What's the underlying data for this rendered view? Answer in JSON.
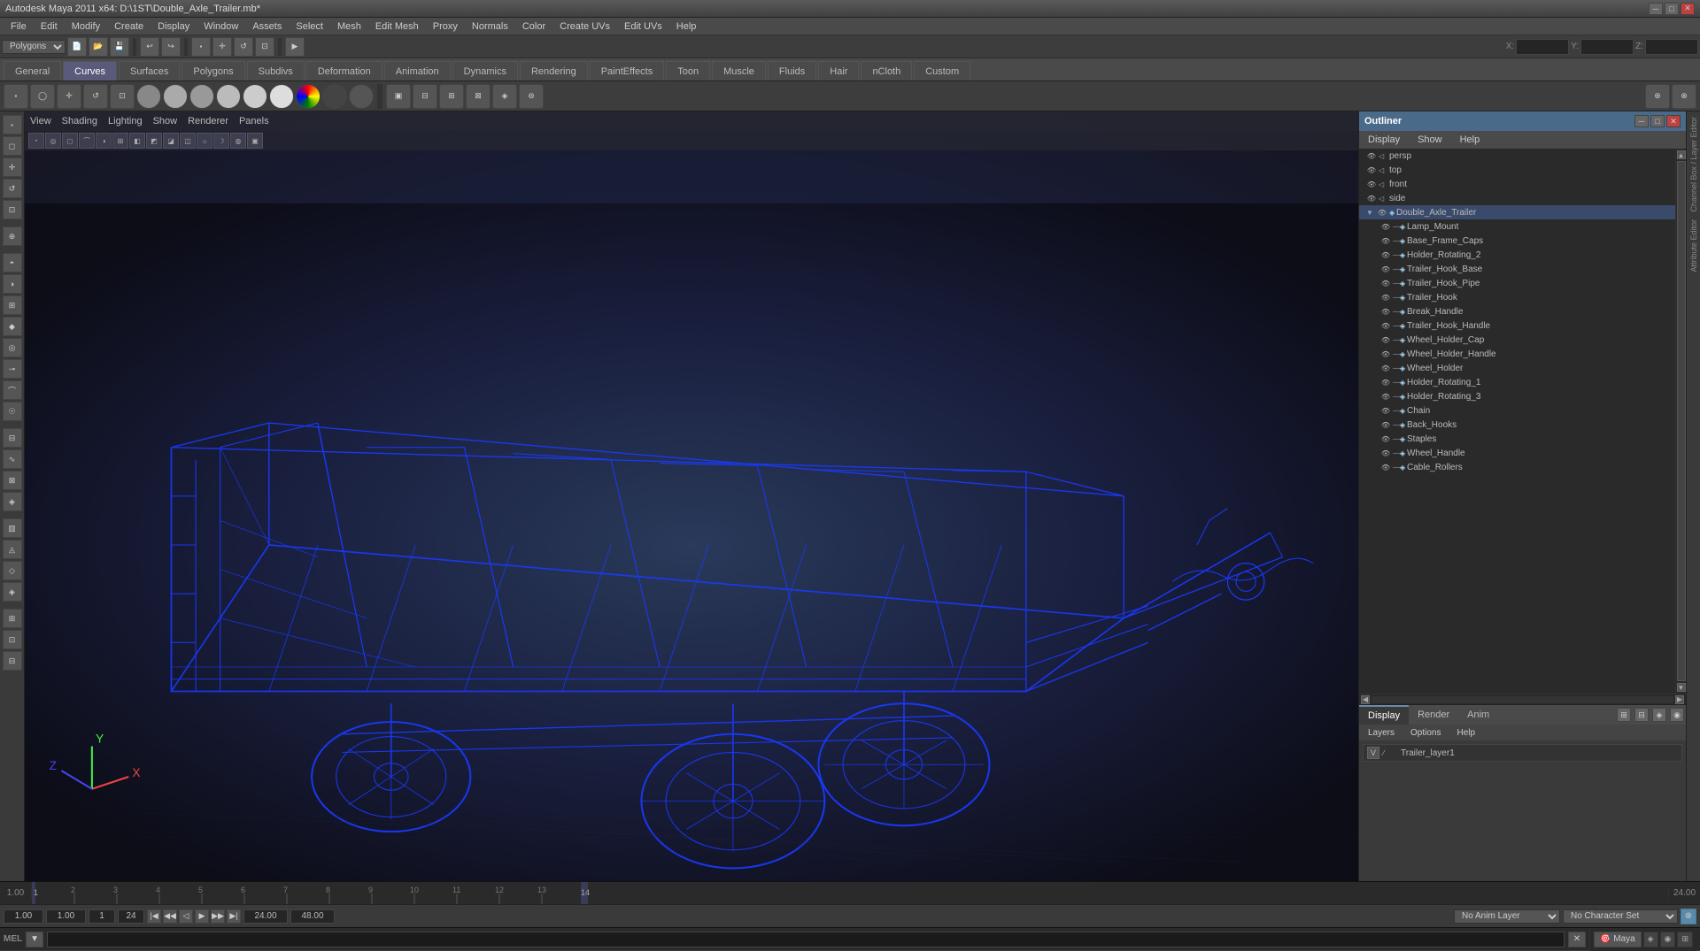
{
  "titleBar": {
    "title": "Autodesk Maya 2011 x64: D:\\1ST\\Double_Axle_Trailer.mb*",
    "btnMin": "─",
    "btnMax": "□",
    "btnClose": "✕"
  },
  "menuBar": {
    "items": [
      "File",
      "Edit",
      "Modify",
      "Create",
      "Display",
      "Window",
      "Assets",
      "Select",
      "Mesh",
      "Edit Mesh",
      "Proxy",
      "Normals",
      "Color",
      "Create UVs",
      "Edit UVs",
      "Help"
    ]
  },
  "modeSelector": {
    "current": "Polygons"
  },
  "tabs": {
    "items": [
      "General",
      "Curves",
      "Surfaces",
      "Polygons",
      "Subdiv s",
      "Deformation",
      "Animation",
      "Dynamics",
      "Rendering",
      "PaintEffects",
      "Toon",
      "Muscle",
      "Fluids",
      "Hair",
      "nCloth",
      "Custom"
    ]
  },
  "viewport": {
    "menus": [
      "View",
      "Shading",
      "Lighting",
      "Show",
      "Renderer",
      "Panels"
    ]
  },
  "outliner": {
    "title": "Outliner",
    "menuItems": [
      "Display",
      "Help",
      "Show"
    ],
    "items": [
      {
        "label": "persp",
        "indent": 0,
        "hasEye": true,
        "hasTri": false
      },
      {
        "label": "top",
        "indent": 0,
        "hasEye": true,
        "hasTri": false
      },
      {
        "label": "front",
        "indent": 0,
        "hasEye": true,
        "hasTri": false
      },
      {
        "label": "side",
        "indent": 0,
        "hasEye": true,
        "hasTri": false
      },
      {
        "label": "Double_Axle_Trailer",
        "indent": 0,
        "hasEye": true,
        "hasTri": true
      },
      {
        "label": "Lamp_Mount",
        "indent": 1
      },
      {
        "label": "Base_Frame_Caps",
        "indent": 1
      },
      {
        "label": "Holder_Rotating_2",
        "indent": 1
      },
      {
        "label": "Trailer_Hook_Base",
        "indent": 1
      },
      {
        "label": "Trailer_Hook_Pipe",
        "indent": 1
      },
      {
        "label": "Trailer_Hook",
        "indent": 1
      },
      {
        "label": "Break_Handle",
        "indent": 1
      },
      {
        "label": "Trailer_Hook_Handle",
        "indent": 1
      },
      {
        "label": "Wheel_Holder_Cap",
        "indent": 1
      },
      {
        "label": "Wheel_Holder_Handle",
        "indent": 1
      },
      {
        "label": "Wheel_Holder",
        "indent": 1
      },
      {
        "label": "Holder_Rotating_1",
        "indent": 1
      },
      {
        "label": "Holder_Rotating_3",
        "indent": 1
      },
      {
        "label": "Chain",
        "indent": 1
      },
      {
        "label": "Back_Hooks",
        "indent": 1
      },
      {
        "label": "Staples",
        "indent": 1
      },
      {
        "label": "Wheel_Handle",
        "indent": 1
      },
      {
        "label": "Cable_Rollers",
        "indent": 1
      }
    ]
  },
  "channelBox": {
    "tabs": [
      "Display",
      "Render",
      "Anim"
    ],
    "activeTab": "Display",
    "menuItems": [
      "Layers",
      "Options",
      "Help"
    ],
    "layers": [
      {
        "name": "Trailer_layer1",
        "visible": "V"
      }
    ]
  },
  "timeline": {
    "startFrame": "1.00",
    "endFrame": "24.00",
    "maxFrame": "48.00",
    "currentFrame": "1.00",
    "rangeStart": "1.00",
    "rangeEnd": "24",
    "animLayer": "No Anim Layer",
    "characterSet": "No Character Set"
  },
  "bottomBar": {
    "xLabel": "X:",
    "yLabel": "Y:",
    "zLabel": "Z:"
  },
  "melBar": {
    "label": "MEL",
    "placeholder": ""
  },
  "axis": {
    "x": "X",
    "y": "Y",
    "z": "Z"
  }
}
